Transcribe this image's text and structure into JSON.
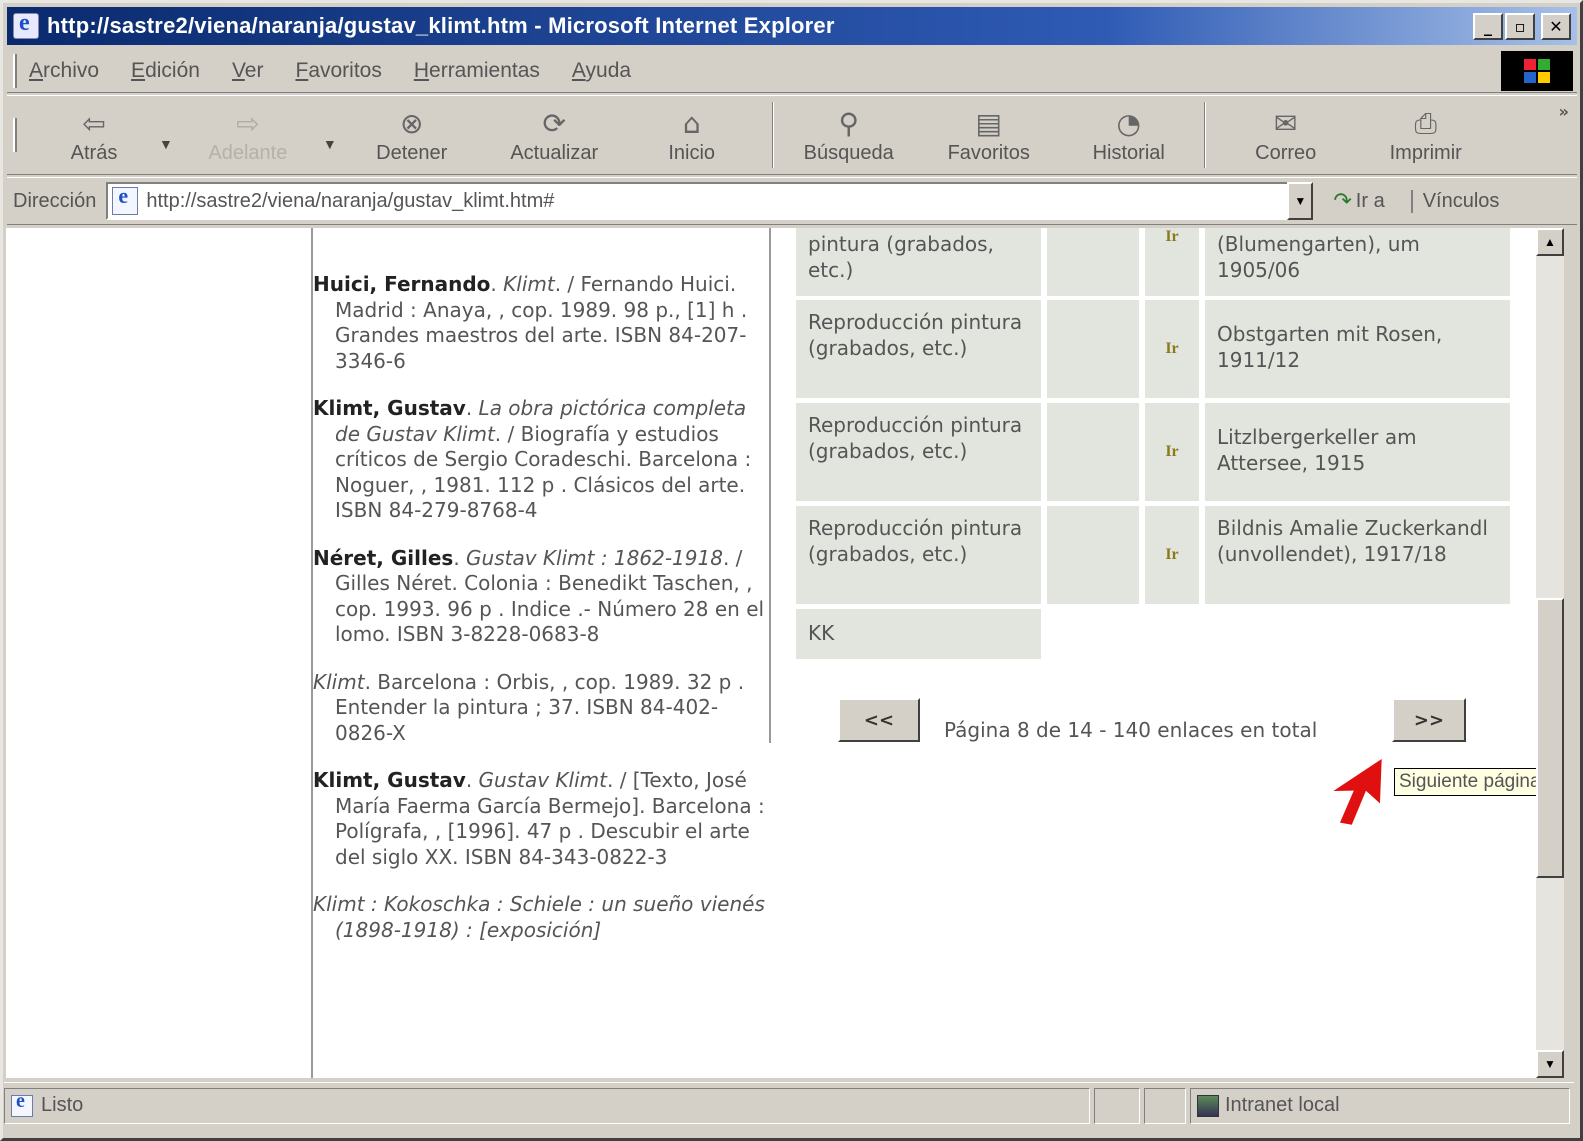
{
  "window": {
    "title": "http://sastre2/viena/naranja/gustav_klimt.htm - Microsoft Internet Explorer",
    "controls": [
      "_",
      "▫",
      "✕"
    ]
  },
  "menu": [
    "Archivo",
    "Edición",
    "Ver",
    "Favoritos",
    "Herramientas",
    "Ayuda"
  ],
  "toolbar": {
    "back": "Atrás",
    "forward": "Adelante",
    "stop": "Detener",
    "refresh": "Actualizar",
    "home": "Inicio",
    "search": "Búsqueda",
    "favorites": "Favoritos",
    "history": "Historial",
    "mail": "Correo",
    "print": "Imprimir"
  },
  "address": {
    "label": "Dirección",
    "url": "http://sastre2/viena/naranja/gustav_klimt.htm#",
    "go": "Ir a",
    "links": "Vínculos"
  },
  "refs": [
    {
      "author": "Huici, Fernando",
      "title": "Klimt",
      "rest": ". / Fernando Huici. Madrid : Anaya, , cop. 1989. 98 p., [1] h . Grandes maestros del arte. ISBN 84-207-3346-6"
    },
    {
      "author": "Klimt, Gustav",
      "title": "La obra pictórica completa de Gustav Klimt",
      "rest": ". / Biografía y estudios críticos de Sergio Coradeschi. Barcelona : Noguer, , 1981. 112 p . Clásicos del arte. ISBN 84-279-8768-4"
    },
    {
      "author": "Néret, Gilles",
      "title": "Gustav Klimt : 1862-1918",
      "rest": ". / Gilles Néret. Colonia : Benedikt Taschen, , cop. 1993. 96 p . Indice .- Número 28 en el lomo. ISBN 3-8228-0683-8"
    },
    {
      "author": "",
      "title": "Klimt",
      "rest": ". Barcelona : Orbis, , cop. 1989. 32 p . Entender la pintura ; 37. ISBN 84-402-0826-X"
    },
    {
      "author": "Klimt, Gustav",
      "title": "Gustav Klimt",
      "rest": ". / [Texto, José María Faerma García Bermejo]. Barcelona : Polígrafa, , [1996]. 47 p . Descubir el arte del siglo XX. ISBN 84-343-0822-3"
    },
    {
      "author": "",
      "title": "Klimt : Kokoschka : Schiele : un sueño vienés (1898-1918) : [exposición]",
      "rest": ""
    }
  ],
  "rows": [
    {
      "type": "pintura (grabados, etc.)",
      "link": "Ir",
      "work": "(Blumengarten), um 1905/06"
    },
    {
      "type": "Reproducción pintura (grabados, etc.)",
      "link": "Ir",
      "work": "Obstgarten mit Rosen, 1911/12"
    },
    {
      "type": "Reproducción pintura (grabados, etc.)",
      "link": "Ir",
      "work": "Litzlbergerkeller am Attersee, 1915"
    },
    {
      "type": "Reproducción pintura (grabados, etc.)",
      "link": "Ir",
      "work": "Bildnis Amalie Zuckerkandl (unvollendet), 1917/18"
    },
    {
      "type": "KK",
      "link": "",
      "work": ""
    }
  ],
  "pager": {
    "prev": "<<",
    "next": ">>",
    "text": "Página 8 de 14 - 140 enlaces en total"
  },
  "tooltip": "Siguiente página",
  "status": {
    "text": "Listo",
    "zone": "Intranet local"
  }
}
